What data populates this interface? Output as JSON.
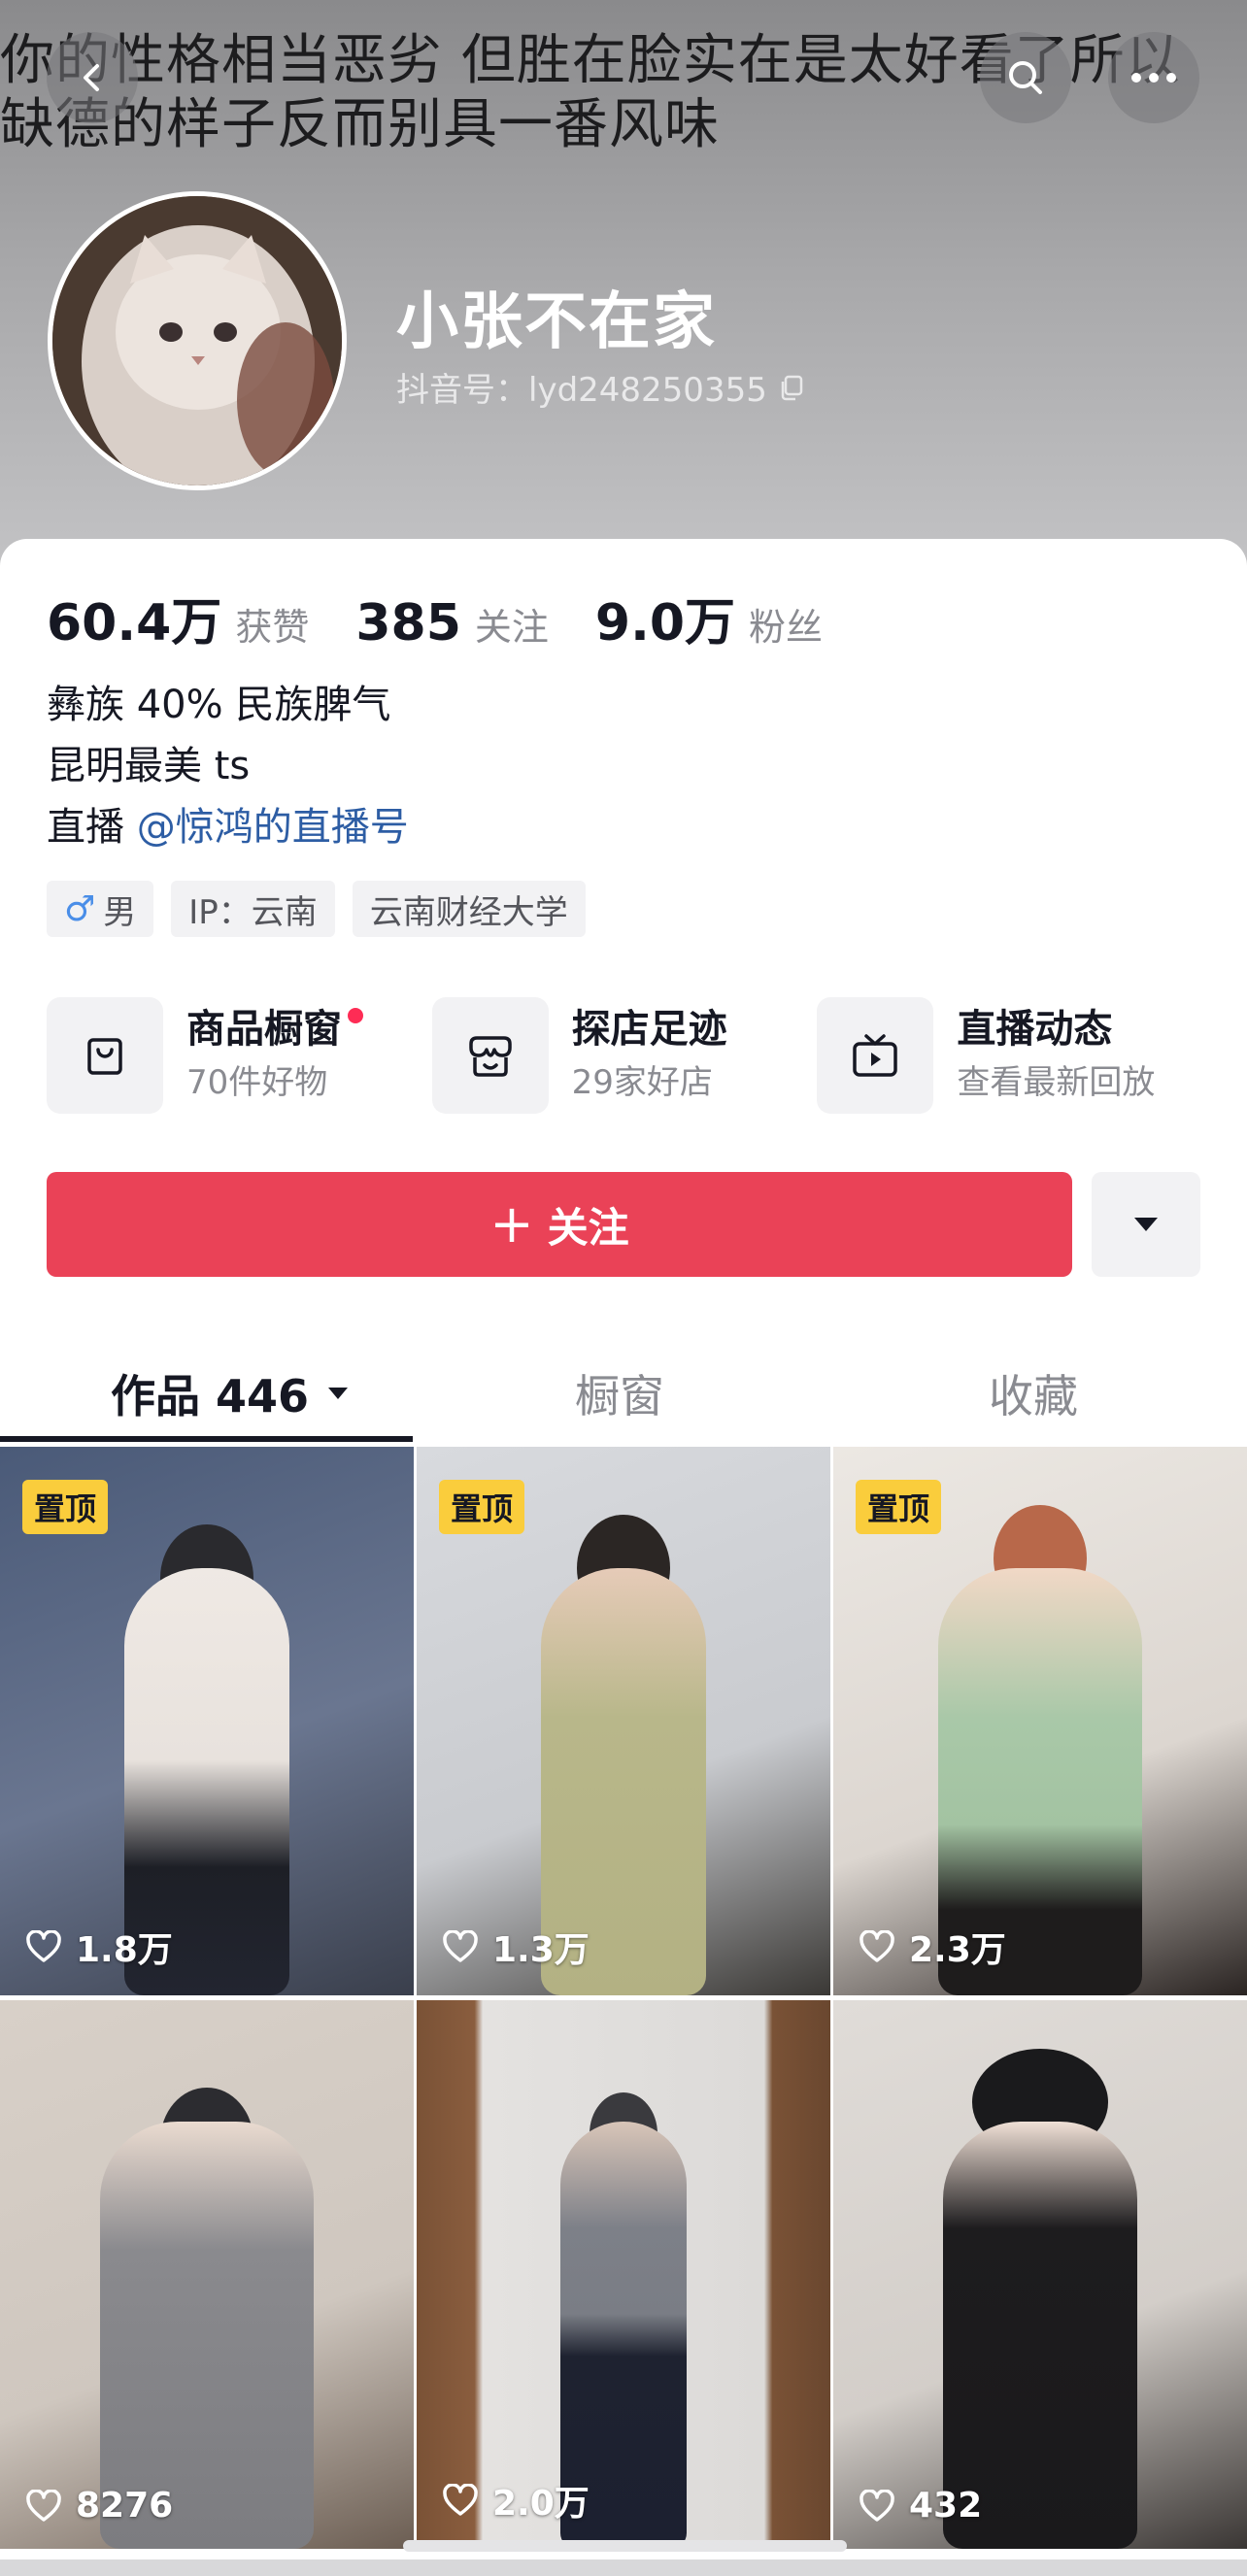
{
  "header": {
    "bg_text_line1": "你的性格相当恶劣 但胜在脸实在是太好看了所以",
    "bg_text_line2": "缺德的样子反而别具一番风味",
    "nickname": "小张不在家",
    "douyin_id": "抖音号：lyd248250355"
  },
  "stats": [
    {
      "value": "60.4万",
      "label": "获赞"
    },
    {
      "value": "385",
      "label": "关注"
    },
    {
      "value": "9.0万",
      "label": "粉丝"
    }
  ],
  "bio": {
    "line1": "彝族 40% 民族脾气",
    "line2": "昆明最美 ts",
    "line3_prefix": "直播",
    "line3_link": "@惊鸿的直播号"
  },
  "tags": {
    "gender": "男",
    "ip": "IP：云南",
    "school": "云南财经大学"
  },
  "features": [
    {
      "title": "商品橱窗",
      "sub": "70件好物",
      "icon": "shopping-bag-icon"
    },
    {
      "title": "探店足迹",
      "sub": "29家好店",
      "icon": "store-icon"
    },
    {
      "title": "直播动态",
      "sub": "查看最新回放",
      "icon": "tv-icon"
    }
  ],
  "follow": {
    "label": "关注"
  },
  "tabs": {
    "works": "作品 446",
    "window": "橱窗",
    "collect": "收藏"
  },
  "videos": [
    {
      "pinned": "置顶",
      "likes": "1.8万"
    },
    {
      "pinned": "置顶",
      "likes": "1.3万"
    },
    {
      "pinned": "置顶",
      "likes": "2.3万"
    },
    {
      "likes": "8276"
    },
    {
      "likes": "2.0万"
    },
    {
      "likes": "432"
    }
  ],
  "colors": {
    "accent": "#ea4257",
    "link": "#2d5da4",
    "pin": "#facd3c"
  }
}
